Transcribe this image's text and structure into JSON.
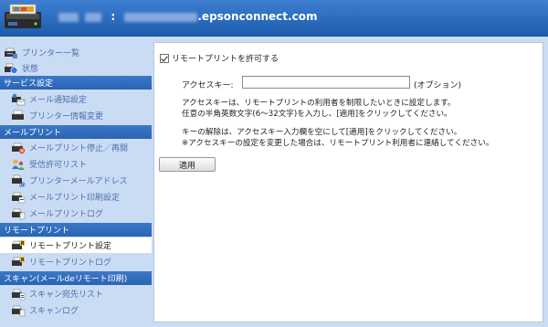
{
  "header": {
    "title_suffix": ".epsonconnect.com",
    "separator": ":",
    "colors": {
      "header_top": "#3f7fd0",
      "header_bottom": "#1f5cab"
    }
  },
  "sidebar": {
    "top_items": [
      {
        "label": "プリンター一覧",
        "icon": "printer-list-icon"
      },
      {
        "label": "状態",
        "icon": "status-icon"
      }
    ],
    "sections": [
      {
        "title": "サービス設定",
        "items": [
          {
            "label": "メール通知設定",
            "icon": "mail-notification-icon"
          },
          {
            "label": "プリンター情報変更",
            "icon": "printer-info-icon"
          }
        ]
      },
      {
        "title": "メールプリント",
        "items": [
          {
            "label": "メールプリント停止／再開",
            "icon": "email-print-pause-icon"
          },
          {
            "label": "受信許可リスト",
            "icon": "approved-senders-icon"
          },
          {
            "label": "プリンターメールアドレス",
            "icon": "printer-email-icon"
          },
          {
            "label": "メールプリント印刷設定",
            "icon": "email-print-settings-icon"
          },
          {
            "label": "メールプリントログ",
            "icon": "email-print-log-icon"
          }
        ]
      },
      {
        "title": "リモートプリント",
        "items": [
          {
            "label": "リモートプリント設定",
            "icon": "remote-print-settings-icon",
            "active": true
          },
          {
            "label": "リモートプリントログ",
            "icon": "remote-print-log-icon"
          }
        ]
      },
      {
        "title": "スキャン(メールdeリモート印刷)",
        "items": [
          {
            "label": "スキャン宛先リスト",
            "icon": "scan-destination-icon"
          },
          {
            "label": "スキャンログ",
            "icon": "scan-log-icon"
          }
        ]
      }
    ]
  },
  "main": {
    "enable_label": "リモートプリントを許可する",
    "enable_checked": true,
    "access_key_label": "アクセスキー:",
    "access_key_value": "",
    "access_key_optional": "(オプション)",
    "description_lines": [
      "アクセスキーは、リモートプリントの利用者を制限したいときに設定します。",
      "任意の半角英数文字(6〜32文字)を入力し、[適用]をクリックしてください。"
    ],
    "clear_lines": [
      "キーの解除は、アクセスキー入力欄を空にして[適用]をクリックしてください。",
      "※アクセスキーの設定を変更した場合は、リモートプリント利用者に連絡してください。"
    ],
    "apply_label": "適用"
  }
}
